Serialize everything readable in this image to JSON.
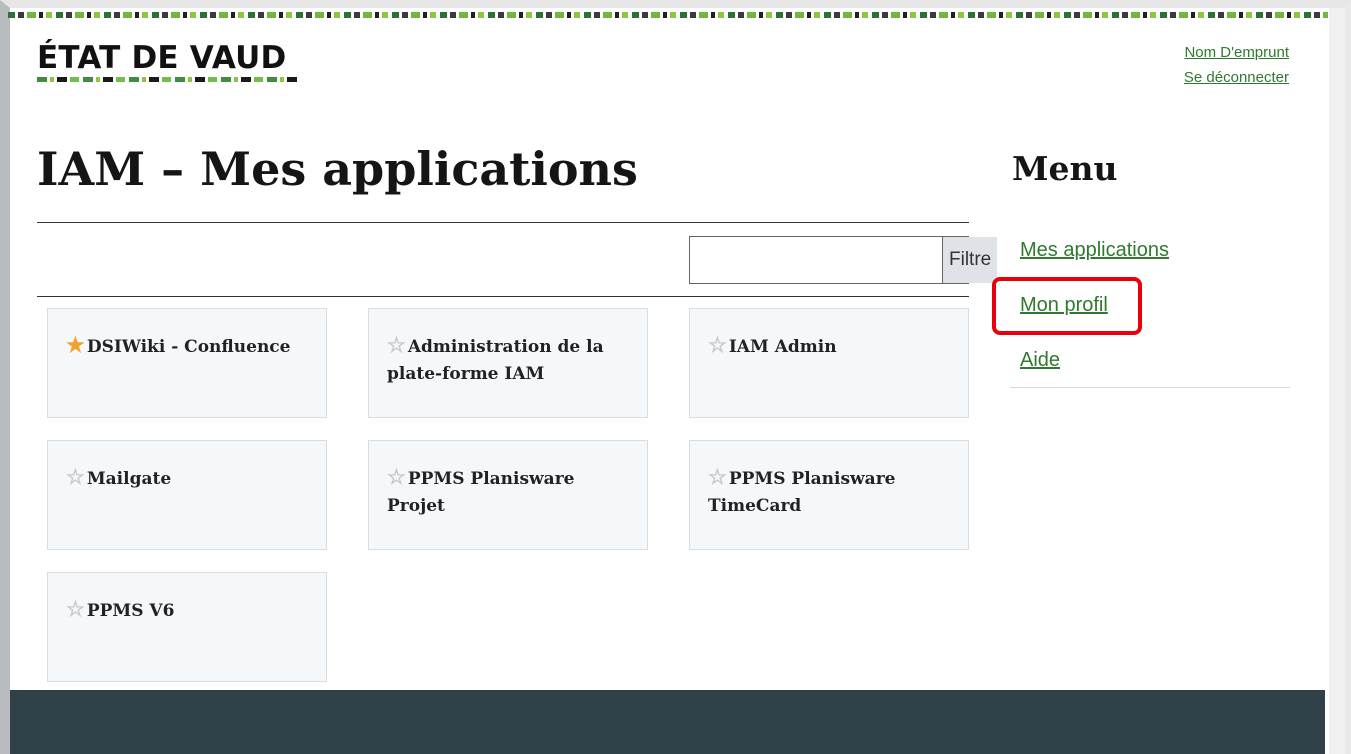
{
  "header": {
    "logo_text": "ÉTAT DE VAUD",
    "user_name": "Nom D'emprunt",
    "logout_label": "Se déconnecter"
  },
  "page": {
    "title": "IAM – Mes applications"
  },
  "filter": {
    "value": "",
    "placeholder": "",
    "button_label": "Filtre"
  },
  "applications": [
    {
      "name": "DSIWiki - Confluence",
      "favorite": true
    },
    {
      "name": "Administration de la plate-forme IAM",
      "favorite": false
    },
    {
      "name": "IAM Admin",
      "favorite": false
    },
    {
      "name": "Mailgate",
      "favorite": false
    },
    {
      "name": "PPMS Planisware Projet",
      "favorite": false
    },
    {
      "name": "PPMS Planisware TimeCard",
      "favorite": false
    },
    {
      "name": "PPMS V6",
      "favorite": false
    }
  ],
  "menu": {
    "title": "Menu",
    "items": [
      {
        "label": "Mes applications"
      },
      {
        "label": "Mon profil",
        "highlighted": true
      },
      {
        "label": "Aide"
      }
    ]
  },
  "icons": {
    "favorite": "star-filled-icon",
    "not_favorite": "star-outline-icon"
  },
  "colors": {
    "link": "#2f7a2f",
    "favorite_star": "#f2a22c",
    "highlight": "#e8000b",
    "footer": "#2f4048"
  }
}
